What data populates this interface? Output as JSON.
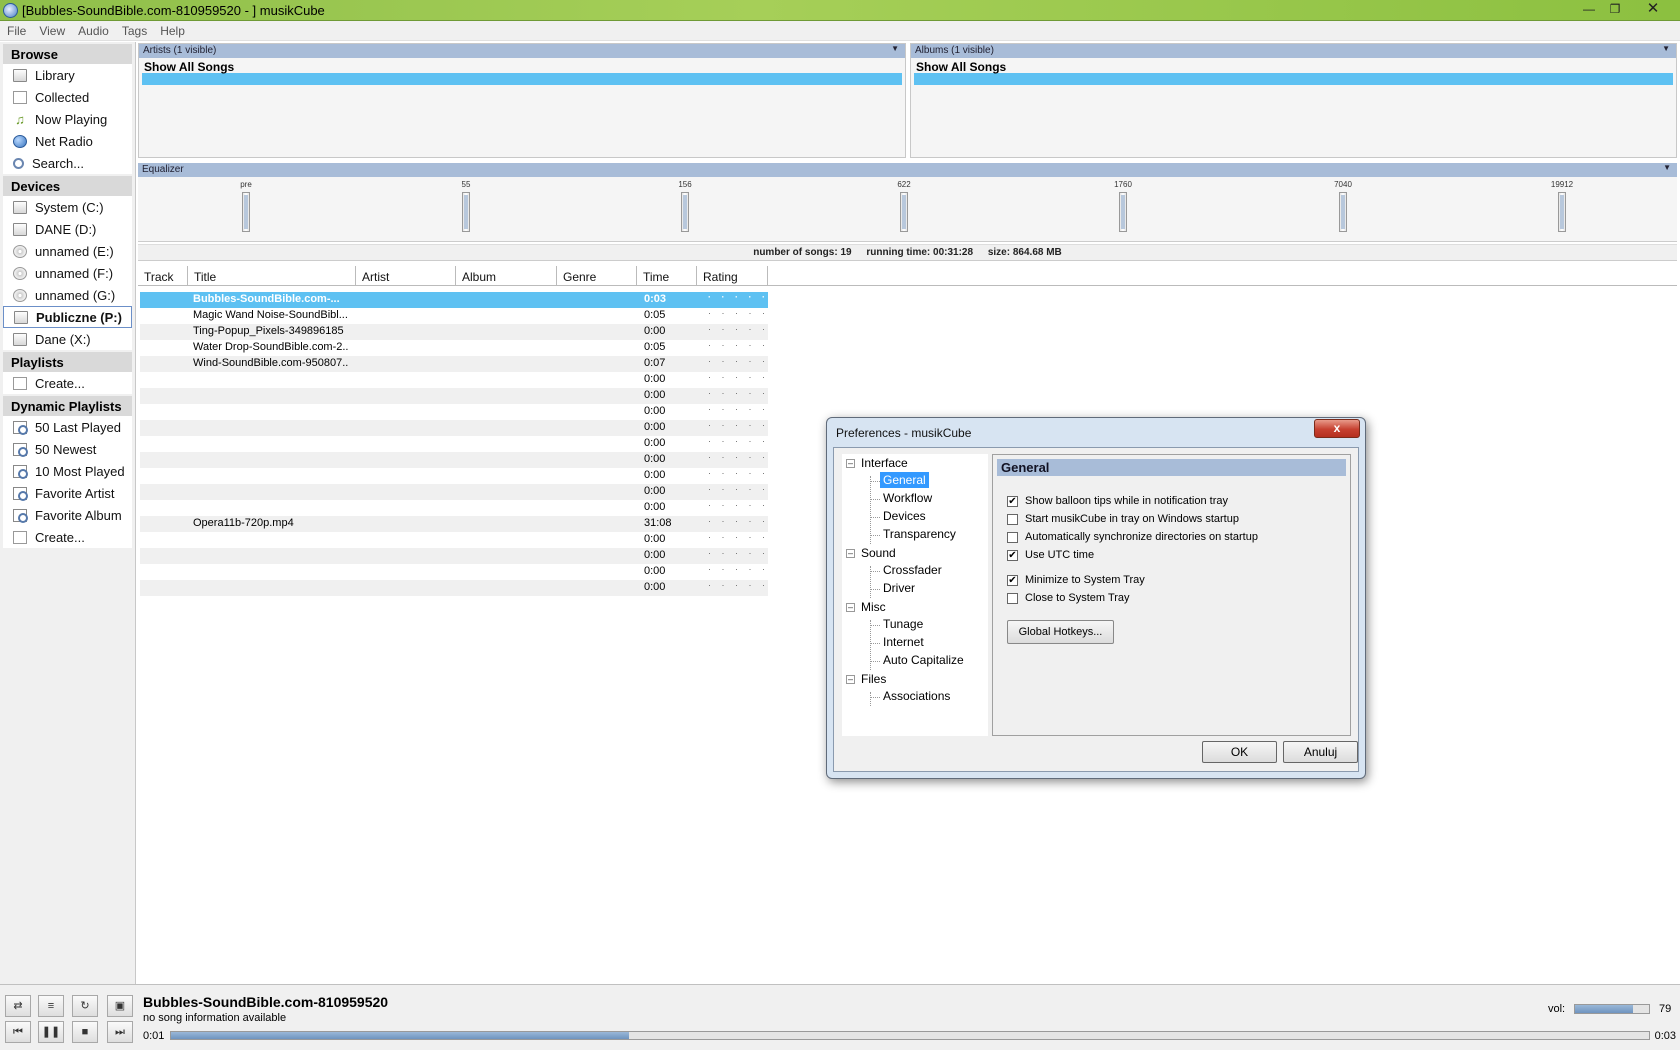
{
  "window": {
    "title": "[Bubbles-SoundBible.com-810959520 - ] musikCube"
  },
  "menu": [
    "File",
    "View",
    "Audio",
    "Tags",
    "Help"
  ],
  "sidebar": {
    "browse": {
      "header": "Browse",
      "items": [
        "Library",
        "Collected",
        "Now Playing",
        "Net Radio",
        "Search..."
      ]
    },
    "devices": {
      "header": "Devices",
      "items": [
        "System (C:)",
        "DANE (D:)",
        "unnamed (E:)",
        "unnamed (F:)",
        "unnamed (G:)",
        "Publiczne (P:)",
        "Dane (X:)"
      ]
    },
    "playlists": {
      "header": "Playlists",
      "items": [
        "Create..."
      ]
    },
    "dynamic": {
      "header": "Dynamic Playlists",
      "items": [
        "50 Last Played",
        "50 Newest",
        "10 Most Played",
        "Favorite Artist",
        "Favorite Album",
        "Create..."
      ]
    }
  },
  "artists": {
    "header": "Artists (1 visible)",
    "first": "Show All Songs"
  },
  "albums": {
    "header": "Albums (1 visible)",
    "first": "Show All Songs"
  },
  "equalizer": {
    "header": "Equalizer",
    "bands": [
      "pre",
      "55",
      "156",
      "622",
      "1760",
      "7040",
      "19912"
    ]
  },
  "status": {
    "songs": "number of songs: 19",
    "runtime": "running time: 00:31:28",
    "size": "size: 864.68 MB"
  },
  "columns": [
    "Track",
    "Title",
    "Artist",
    "Album",
    "Genre",
    "Time",
    "Rating"
  ],
  "songs": [
    {
      "title": "Bubbles-SoundBible.com-...",
      "time": "0:03"
    },
    {
      "title": "Magic Wand Noise-SoundBibl...",
      "time": "0:05"
    },
    {
      "title": "Ting-Popup_Pixels-349896185",
      "time": "0:00"
    },
    {
      "title": "Water Drop-SoundBible.com-2...",
      "time": "0:05"
    },
    {
      "title": "Wind-SoundBible.com-950807...",
      "time": "0:07"
    },
    {
      "title": "",
      "time": "0:00"
    },
    {
      "title": "",
      "time": "0:00"
    },
    {
      "title": "",
      "time": "0:00"
    },
    {
      "title": "",
      "time": "0:00"
    },
    {
      "title": "",
      "time": "0:00"
    },
    {
      "title": "",
      "time": "0:00"
    },
    {
      "title": "",
      "time": "0:00"
    },
    {
      "title": "",
      "time": "0:00"
    },
    {
      "title": "",
      "time": "0:00"
    },
    {
      "title": "Opera11b-720p.mp4",
      "time": "31:08"
    },
    {
      "title": "",
      "time": "0:00"
    },
    {
      "title": "",
      "time": "0:00"
    },
    {
      "title": "",
      "time": "0:00"
    },
    {
      "title": "",
      "time": "0:00"
    }
  ],
  "rating_dots": "· · · · ·",
  "dialog": {
    "title": "Preferences - musikCube",
    "close": "x",
    "tree": {
      "interface": "Interface",
      "general": "General",
      "workflow": "Workflow",
      "devices": "Devices",
      "transparency": "Transparency",
      "sound": "Sound",
      "crossfader": "Crossfader",
      "driver": "Driver",
      "misc": "Misc",
      "tunage": "Tunage",
      "internet": "Internet",
      "autocap": "Auto Capitalize",
      "files": "Files",
      "associations": "Associations"
    },
    "panel_title": "General",
    "options": [
      {
        "label": "Show balloon tips while in notification tray",
        "checked": true
      },
      {
        "label": "Start musikCube in tray on Windows startup",
        "checked": false
      },
      {
        "label": "Automatically synchronize directories on startup",
        "checked": false
      },
      {
        "label": "Use UTC time",
        "checked": true
      },
      {
        "label": "Minimize to System Tray",
        "checked": true
      },
      {
        "label": "Close to System Tray",
        "checked": false
      }
    ],
    "hotkeys": "Global Hotkeys...",
    "ok": "OK",
    "cancel": "Anuluj"
  },
  "player": {
    "now_title": "Bubbles-SoundBible.com-810959520",
    "now_info": "no song information available",
    "elapsed": "0:01",
    "total": "0:03",
    "progress": 0.31,
    "volume_label": "vol:",
    "volume": 79
  },
  "colors": {
    "selection": "#5ec1f2",
    "header": "#a8bcd8"
  }
}
